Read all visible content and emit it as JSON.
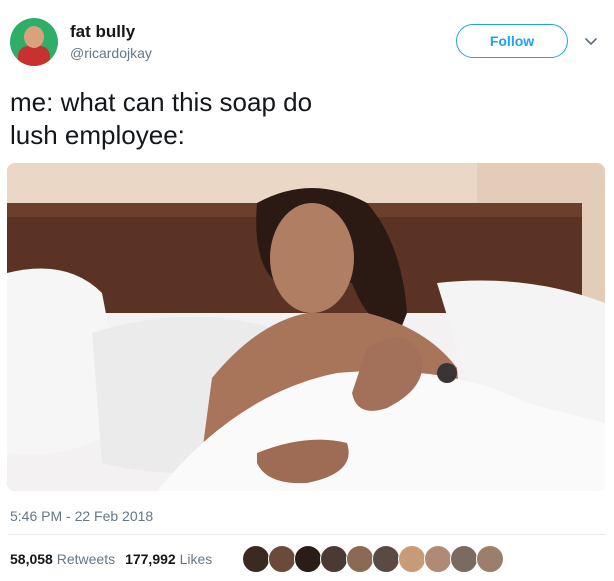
{
  "user": {
    "name": "fat bully",
    "handle": "@ricardojkay"
  },
  "follow_label": "Follow",
  "tweet": {
    "text": "me: what can this soap do\nlush employee:"
  },
  "timestamp": "5:46 PM - 22 Feb 2018",
  "stats": {
    "retweets_count": "58,058",
    "retweets_label": "Retweets",
    "likes_count": "177,992",
    "likes_label": "Likes"
  },
  "colors": {
    "accent": "#1da1f2",
    "muted": "#657786",
    "text": "#14171a"
  },
  "likers": [
    "#3a2a22",
    "#6b4a3a",
    "#2a1d18",
    "#4a3a34",
    "#8a6a55",
    "#5a4a44",
    "#c79a7a",
    "#b08a75",
    "#7a6a60",
    "#9c7f6a"
  ]
}
